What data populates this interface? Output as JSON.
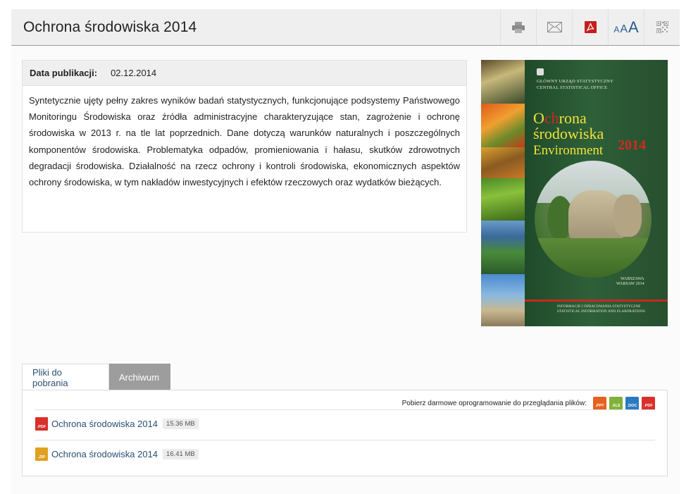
{
  "header": {
    "title": "Ochrona środowiska 2014",
    "font_sizes": [
      "A",
      "A",
      "A"
    ],
    "tools": [
      "print-icon",
      "mail-icon",
      "pdf-icon",
      "font-size-icon",
      "qr-code-icon"
    ]
  },
  "details": {
    "pub_label": "Data publikacji:",
    "pub_date": "02.12.2014",
    "description": "Syntetycznie ujęty pełny zakres wyników badań statystycznych, funkcjonujące podsystemy Państwowego Monitoringu Środowiska oraz źródła administracyjne charakteryzujące stan, zagrożenie i ochronę środowiska w 2013 r. na tle lat poprzednich. Dane dotyczą warunków naturalnych i poszczególnych komponentów środowiska. Problematyka odpadów, promieniowania i hałasu, skutków zdrowotnych degradacji środowiska. Działalność na rzecz ochrony i kontroli środowiska, ekonomicznych aspektów ochrony środowiska, w tym nakładów inwestycyjnych i efektów rzeczowych oraz wydatków bieżących."
  },
  "cover": {
    "publisher_pl": "GŁÓWNY URZĄD STATYSTYCZNY",
    "publisher_en": "CENTRAL STATISTICAL OFFICE",
    "title_o": "O",
    "title_ch": "ch",
    "title_rona": "rona",
    "title_line2": "środowiska",
    "title_line3": "Environment",
    "year": "2014",
    "place_line1": "WARSZAWA",
    "place_line2": "WARSAW 2014",
    "series_pl": "INFORMACJE I OPRACOWANIA STATYSTYCZNE",
    "series_en": "STATISTICAL INFORMATION AND ELABORATIONS"
  },
  "tabs": {
    "downloads": "Pliki do pobrania",
    "archive": "Archiwum"
  },
  "software": {
    "label": "Pobierz darmowe oprogramowanie do przeglądania plików:",
    "types": [
      ".PPT",
      ".XLS",
      ".DOC",
      ".PDF"
    ]
  },
  "files": [
    {
      "ext": ".PDF",
      "name": "Ochrona środowiska 2014",
      "size": "15.36 MB",
      "color": "#d9302a"
    },
    {
      "ext": ".ZIP",
      "name": "Ochrona środowiska 2014",
      "size": "16.41 MB",
      "color": "#e0a020"
    }
  ]
}
